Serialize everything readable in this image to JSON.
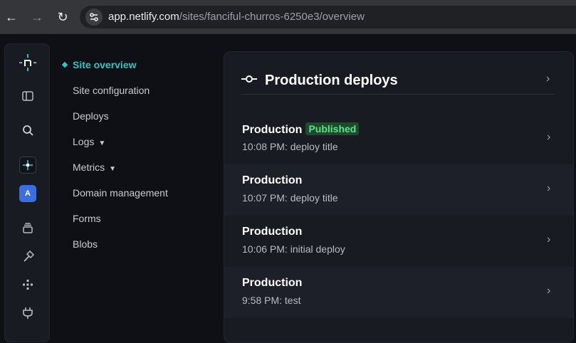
{
  "browser": {
    "url_host": "app.netlify.com",
    "url_path": "/sites/fanciful-churros-6250e3/overview"
  },
  "icons": {
    "back": "back-arrow-icon",
    "forward": "forward-arrow-icon",
    "reload": "reload-icon",
    "site_settings": "tune-icon"
  },
  "rail": {
    "avatar_letter": "A"
  },
  "sidebar": {
    "items": [
      {
        "label": "Site overview",
        "active": true,
        "has_caret": false
      },
      {
        "label": "Site configuration",
        "active": false,
        "has_caret": false
      },
      {
        "label": "Deploys",
        "active": false,
        "has_caret": false
      },
      {
        "label": "Logs",
        "active": false,
        "has_caret": true
      },
      {
        "label": "Metrics",
        "active": false,
        "has_caret": true
      },
      {
        "label": "Domain management",
        "active": false,
        "has_caret": false
      },
      {
        "label": "Forms",
        "active": false,
        "has_caret": false
      },
      {
        "label": "Blobs",
        "active": false,
        "has_caret": false
      }
    ]
  },
  "card": {
    "title": "Production deploys",
    "deploys": [
      {
        "name": "Production",
        "badge": "Published",
        "meta": "10:08 PM: deploy title"
      },
      {
        "name": "Production",
        "badge": "",
        "meta": "10:07 PM: deploy title"
      },
      {
        "name": "Production",
        "badge": "",
        "meta": "10:06 PM: initial deploy"
      },
      {
        "name": "Production",
        "badge": "",
        "meta": "9:58 PM: test"
      }
    ]
  },
  "colors": {
    "accent": "#32c3c0",
    "published_text": "#5fe08b",
    "published_bg": "#1f4a2e",
    "avatar_bg": "#3b6fe0"
  }
}
